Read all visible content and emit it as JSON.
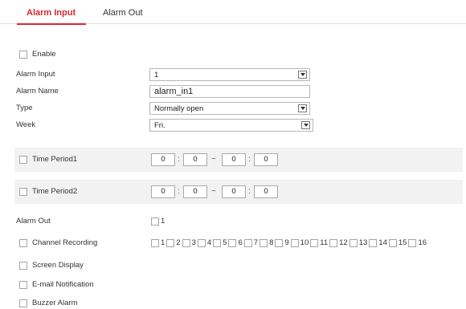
{
  "tabs": [
    {
      "label": "Alarm Input",
      "active": true
    },
    {
      "label": "Alarm Out",
      "active": false
    }
  ],
  "enable": {
    "label": "Enable",
    "checked": false
  },
  "alarm_input": {
    "label": "Alarm Input",
    "value": "1"
  },
  "alarm_name": {
    "label": "Alarm Name",
    "value": "alarm_in1"
  },
  "type": {
    "label": "Type",
    "value": "Normally open"
  },
  "week": {
    "label": "Week",
    "value": "Fri."
  },
  "time_period1": {
    "label": "Time Period1",
    "checked": false,
    "start_hour": "0",
    "start_min": "0",
    "sep": "~",
    "end_hour": "0",
    "end_min": "0",
    "colon": ":"
  },
  "time_period2": {
    "label": "Time Period2",
    "checked": false,
    "start_hour": "0",
    "start_min": "0",
    "sep": "~",
    "end_hour": "0",
    "end_min": "0",
    "colon": ":"
  },
  "alarm_out": {
    "label": "Alarm Out",
    "options": [
      "1"
    ]
  },
  "channel_recording": {
    "label": "Channel Recording",
    "channels": [
      "1",
      "2",
      "3",
      "4",
      "5",
      "6",
      "7",
      "8",
      "9",
      "10",
      "11",
      "12",
      "13",
      "14",
      "15",
      "16"
    ]
  },
  "screen_display": {
    "label": "Screen Display",
    "checked": false
  },
  "email_notification": {
    "label": "E-mail Notification",
    "checked": false
  },
  "buzzer_alarm": {
    "label": "Buzzer Alarm",
    "checked": false
  },
  "colors": {
    "accent": "#d9272e",
    "band": "#f2f2f2",
    "border": "#b7b7b7"
  }
}
